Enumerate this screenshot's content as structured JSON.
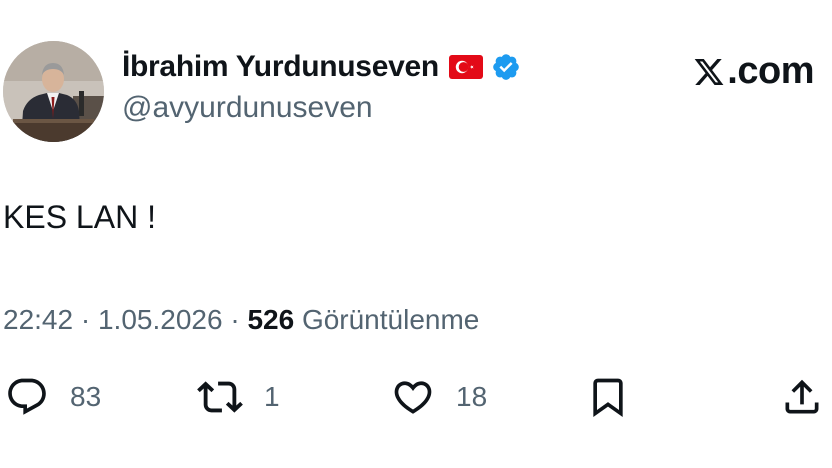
{
  "author": {
    "display_name": "İbrahim Yurdunuseven",
    "handle": "@avyurdunuseven",
    "flag": "turkey-flag",
    "verified": true,
    "verified_color": "#1d9bf0"
  },
  "brand": {
    "domain_text": ".com",
    "logo": "x-logo"
  },
  "tweet": {
    "text": "KES LAN !",
    "time": "22:42",
    "date": "1.05.2026",
    "views_count": "526",
    "views_label": "Görüntülenme"
  },
  "actions": {
    "replies": "83",
    "retweets": "1",
    "likes": "18"
  },
  "icons": [
    "reply-icon",
    "retweet-icon",
    "like-icon",
    "bookmark-icon",
    "share-icon"
  ],
  "colors": {
    "text_primary": "#0f1419",
    "text_secondary": "#536471",
    "flag_red": "#e30a17"
  }
}
